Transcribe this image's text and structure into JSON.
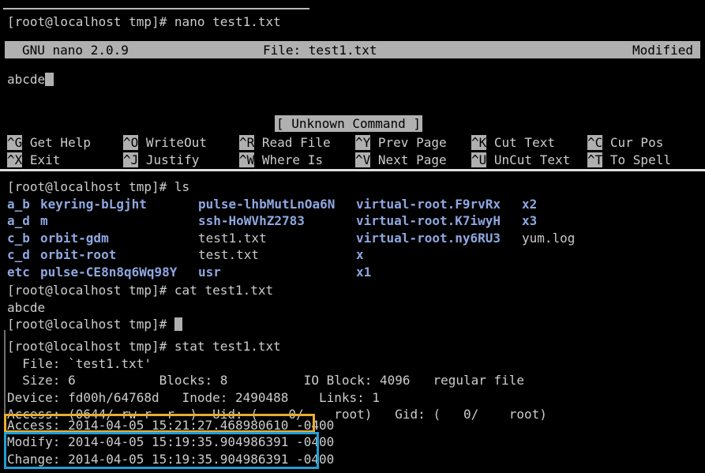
{
  "terminal": {
    "prompt": "[root@localhost tmp]#",
    "foreground_color": "#cccccc",
    "background_color": "#000000",
    "dir_color": "#8fa7e0",
    "highlight_access_color": "#e8ad2e",
    "highlight_modchange_color": "#1f9fd6"
  },
  "top_command_line": "[root@localhost tmp]# nano test1.txt",
  "nano": {
    "title_app": "GNU nano 2.0.9",
    "title_file": "File: test1.txt",
    "title_status": "Modified",
    "buffer_text": "abcde",
    "status_message": "[ Unknown Command ]",
    "shortcuts_row1": [
      {
        "key": "^G",
        "label": " Get Help"
      },
      {
        "key": "^O",
        "label": " WriteOut"
      },
      {
        "key": "^R",
        "label": " Read File"
      },
      {
        "key": "^Y",
        "label": " Prev Page"
      },
      {
        "key": "^K",
        "label": " Cut Text"
      },
      {
        "key": "^C",
        "label": " Cur Pos"
      }
    ],
    "shortcuts_row2": [
      {
        "key": "^X",
        "label": " Exit"
      },
      {
        "key": "^J",
        "label": " Justify"
      },
      {
        "key": "^W",
        "label": " Where Is"
      },
      {
        "key": "^V",
        "label": " Next Page"
      },
      {
        "key": "^U",
        "label": " UnCut Text"
      },
      {
        "key": "^T",
        "label": " To Spell"
      }
    ]
  },
  "shell": {
    "ls_command": "[root@localhost tmp]# ls",
    "ls_rows": [
      [
        {
          "text": "a_b",
          "type": "dir"
        },
        {
          "text": "keyring-bLgjht",
          "type": "dir"
        },
        {
          "text": "pulse-lhbMutLnOa6N",
          "type": "dir"
        },
        {
          "text": "virtual-root.F9rvRx",
          "type": "dir"
        },
        {
          "text": "x2",
          "type": "dir"
        }
      ],
      [
        {
          "text": "a_d",
          "type": "dir"
        },
        {
          "text": "m",
          "type": "dir"
        },
        {
          "text": "ssh-HoWVhZ2783",
          "type": "dir"
        },
        {
          "text": "virtual-root.K7iwyH",
          "type": "dir"
        },
        {
          "text": "x3",
          "type": "dir"
        }
      ],
      [
        {
          "text": "c_b",
          "type": "dir"
        },
        {
          "text": "orbit-gdm",
          "type": "dir"
        },
        {
          "text": "test1.txt",
          "type": "file"
        },
        {
          "text": "virtual-root.ny6RU3",
          "type": "dir"
        },
        {
          "text": "yum.log",
          "type": "file"
        }
      ],
      [
        {
          "text": "c_d",
          "type": "dir"
        },
        {
          "text": "orbit-root",
          "type": "dir"
        },
        {
          "text": "test.txt",
          "type": "file"
        },
        {
          "text": "x",
          "type": "dir"
        },
        {
          "text": "",
          "type": "file"
        }
      ],
      [
        {
          "text": "etc",
          "type": "dir"
        },
        {
          "text": "pulse-CE8n8q6Wq98Y",
          "type": "dir"
        },
        {
          "text": "usr",
          "type": "dir"
        },
        {
          "text": "x1",
          "type": "dir"
        },
        {
          "text": "",
          "type": "file"
        }
      ]
    ],
    "cat_command": "[root@localhost tmp]# cat test1.txt",
    "cat_output": "abcde",
    "idle_prompt": "[root@localhost tmp]# ",
    "stat_command": "[root@localhost tmp]# stat test1.txt",
    "stat_lines": [
      "  File: `test1.txt'",
      "  Size: 6           Blocks: 8          IO Block: 4096   regular file",
      "Device: fd00h/64768d   Inode: 2490488    Links: 1",
      "Access: (0644/-rw-r--r--)  Uid: (    0/    root)   Gid: (   0/    root)"
    ],
    "stat_access_time": "Access: 2014-04-05 15:21:27.468980610",
    "stat_access_tz": " -0400",
    "stat_modify_time": "Modify: 2014-04-05 15:19:35.904986391",
    "stat_modify_tz": " -0400",
    "stat_change_time": "Change: 2014-04-05 15:19:35.904986391",
    "stat_change_tz": " -0400"
  }
}
